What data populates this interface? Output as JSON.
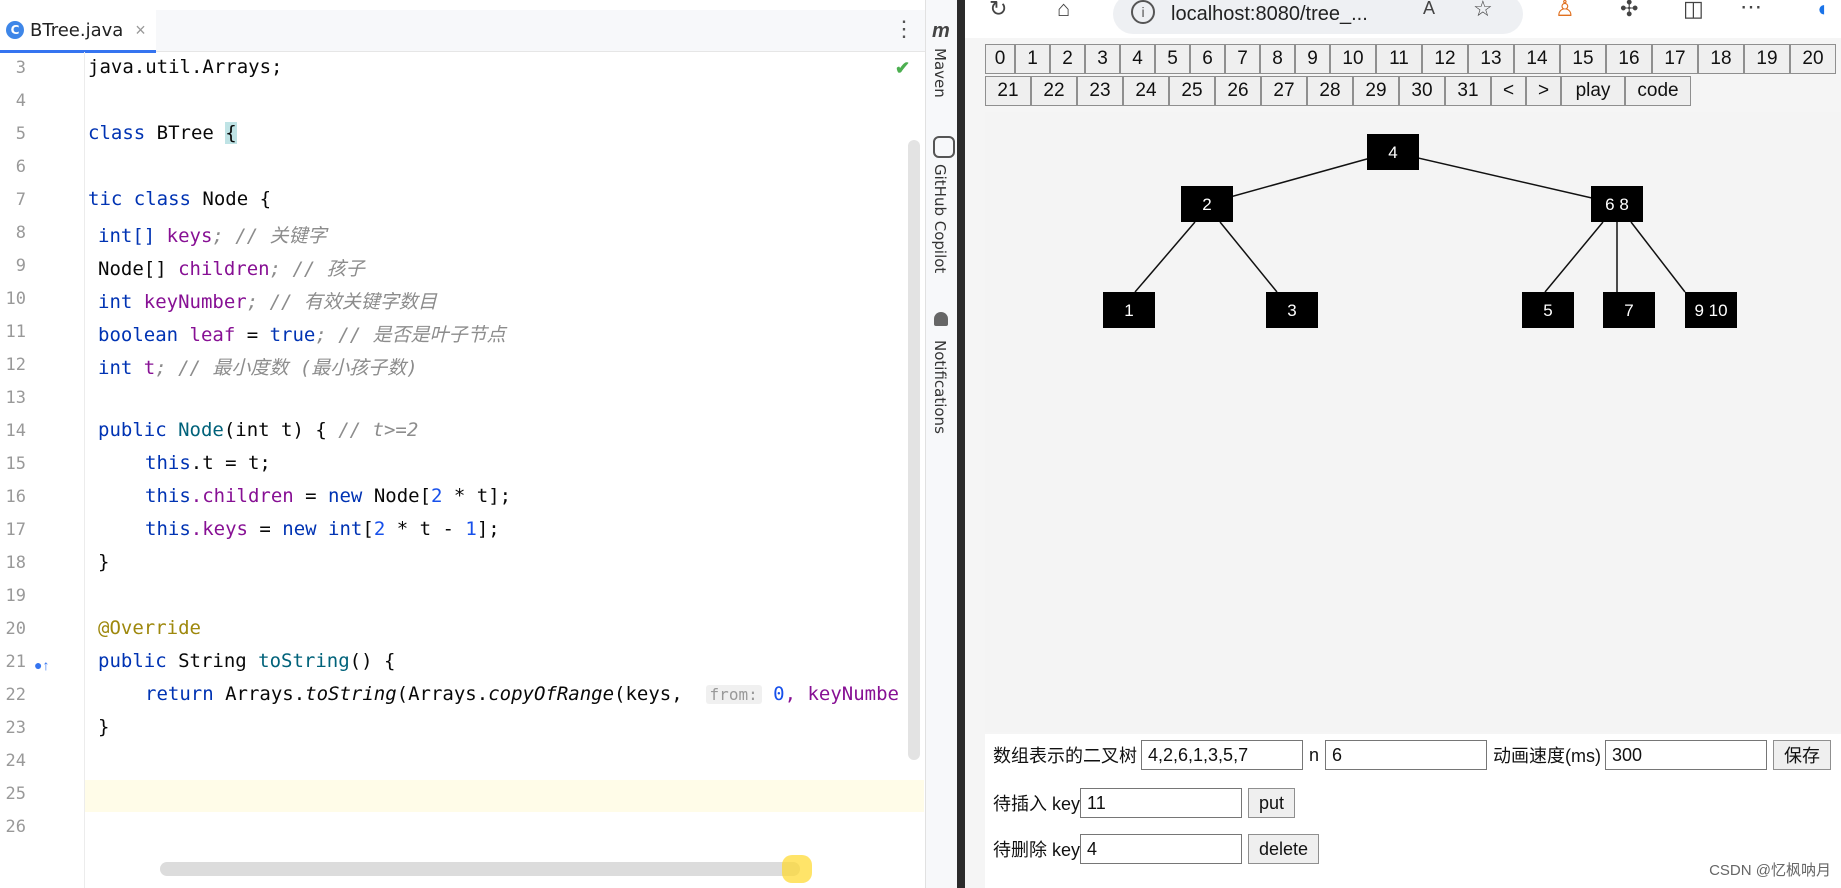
{
  "ide": {
    "tab_title": "BTree.java",
    "tab_icon_letter": "C",
    "side_tools": [
      "Maven",
      "GitHub Copilot",
      "Notifications"
    ],
    "line_numbers": [
      "3",
      "4",
      "5",
      "6",
      "7",
      "8",
      "9",
      "10",
      "11",
      "12",
      "13",
      "14",
      "15",
      "16",
      "17",
      "18",
      "19",
      "20",
      "21",
      "22",
      "23",
      "24",
      "25",
      "26"
    ],
    "code": {
      "l3": "java.util.Arrays;",
      "l5_kw": "class",
      "l5_name": " BTree ",
      "l5_brace": "{",
      "l7_kw": "tic class",
      "l7_rest": " Node {",
      "l8_type": "int[] ",
      "l8_field": "keys",
      "l8_cmt": "; // 关键字",
      "l9_type": "Node[] ",
      "l9_field": "children",
      "l9_cmt": "; // 孩子",
      "l10_type": "int ",
      "l10_field": "keyNumber",
      "l10_cmt": "; // 有效关键字数目",
      "l11_type": "boolean ",
      "l11_field": "leaf",
      "l11_mid": " = ",
      "l11_val": "true",
      "l11_cmt": "; // 是否是叶子节点",
      "l12_type": "int ",
      "l12_field": "t",
      "l12_cmt": "; // 最小度数 (最小孩子数)",
      "l14_kw": "public ",
      "l14_meth": "Node",
      "l14_params": "(int t) { ",
      "l14_cmt": "// t>=2",
      "l15_this": "this",
      "l15_rest": ".t = t;",
      "l16_this": "this",
      "l16_field": ".children",
      "l16_mid": " = ",
      "l16_new": "new",
      "l16_rest": " Node[",
      "l16_num": "2",
      "l16_end": " * t];",
      "l17_this": "this",
      "l17_field": ".keys",
      "l17_mid": " = ",
      "l17_new": "new int",
      "l17_rest": "[",
      "l17_num": "2",
      "l17_mid2": " * t - ",
      "l17_num2": "1",
      "l17_end": "];",
      "l18": "}",
      "l20": "@Override",
      "l21_kw": "public ",
      "l21_rest": "String ",
      "l21_meth": "toString",
      "l21_end": "() {",
      "l22_kw": "return ",
      "l22_a": "Arrays.",
      "l22_m1": "toString",
      "l22_b": "(Arrays.",
      "l22_m2": "copyOfRange",
      "l22_c": "(keys,  ",
      "l22_hint": "from:",
      "l22_num": " 0",
      "l22_d": ", keyNumbe",
      "l23": "}"
    }
  },
  "browser": {
    "url": "localhost:8080/tree_...",
    "buttons_row1": [
      "0",
      "1",
      "2",
      "3",
      "4",
      "5",
      "6",
      "7",
      "8",
      "9",
      "10",
      "11",
      "12",
      "13",
      "14",
      "15",
      "16",
      "17",
      "18",
      "19",
      "20"
    ],
    "buttons_row2": [
      "21",
      "22",
      "23",
      "24",
      "25",
      "26",
      "27",
      "28",
      "29",
      "30",
      "31",
      "<",
      ">",
      "play",
      "code"
    ],
    "tree_nodes": [
      "4",
      "2",
      "6 8",
      "1",
      "3",
      "5",
      "7",
      "9 10"
    ],
    "form": {
      "array_label": "数组表示的二叉树",
      "array_value": "4,2,6,1,3,5,7",
      "n_label": "n",
      "n_value": "6",
      "speed_label": "动画速度(ms)",
      "speed_value": "300",
      "save_label": "保存",
      "insert_label": "待插入 key",
      "insert_value": "11",
      "put_label": "put",
      "delete_label": "待删除 key",
      "delete_value": "4",
      "delete_button_label": "delete"
    },
    "watermark": "CSDN @忆枫呐月"
  }
}
